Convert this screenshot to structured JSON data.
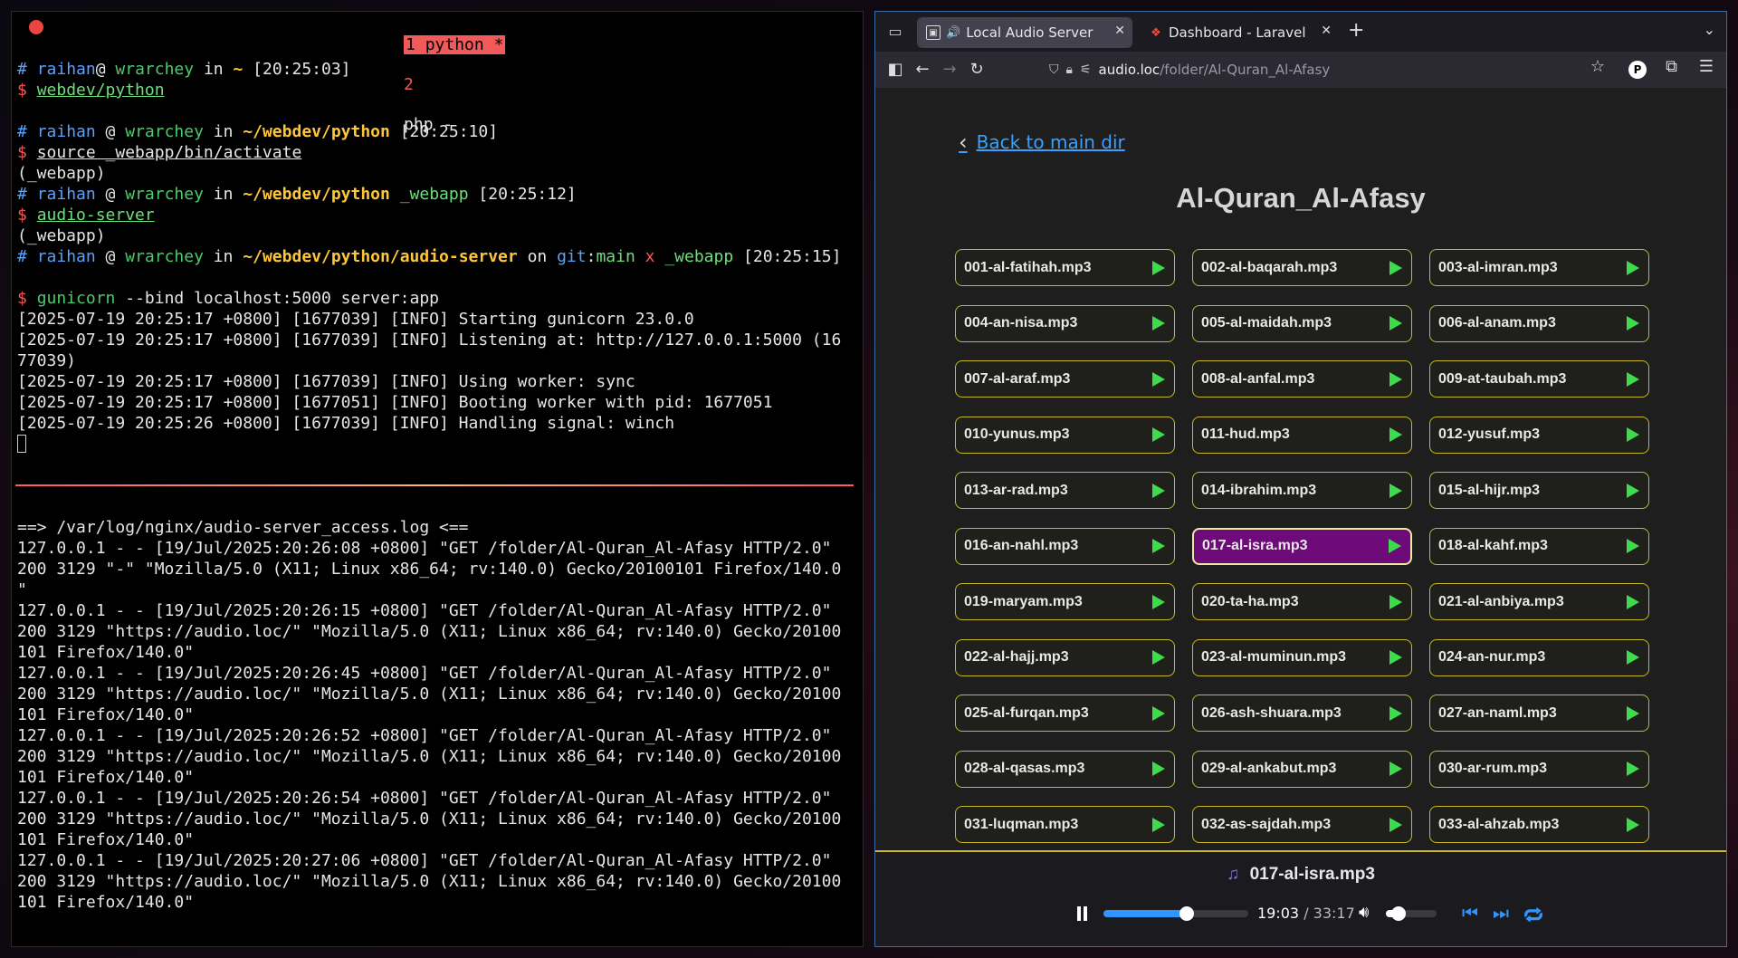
{
  "terminal": {
    "tabs": {
      "active": "1 python *",
      "other_num": "2",
      "other_label": "php -"
    },
    "lines": [
      [
        [
          "c-hash",
          "# "
        ],
        [
          "c-user",
          "raihan"
        ],
        [
          "",
          "@"
        ],
        [
          "c-host",
          " wrarchey"
        ],
        [
          "",
          " in "
        ],
        [
          "c-path",
          "~"
        ],
        [
          "",
          " [20:25:03]"
        ]
      ],
      [
        [
          "c-dollar",
          "$ "
        ],
        [
          "c-cmd",
          "webdev/python"
        ]
      ],
      [
        [
          "",
          ""
        ]
      ],
      [
        [
          "c-hash",
          "# "
        ],
        [
          "c-user",
          "raihan"
        ],
        [
          "",
          " @ "
        ],
        [
          "c-host",
          "wrarchey"
        ],
        [
          "",
          " in "
        ],
        [
          "c-path",
          "~/webdev/python"
        ],
        [
          "",
          " [20:25:10]"
        ]
      ],
      [
        [
          "c-dollar",
          "$ "
        ],
        [
          "c-cmd2",
          "source _webapp/bin/activate"
        ]
      ],
      [
        [
          "",
          "(_webapp)"
        ]
      ],
      [
        [
          "c-hash",
          "# "
        ],
        [
          "c-user",
          "raihan"
        ],
        [
          "",
          " @ "
        ],
        [
          "c-host",
          "wrarchey"
        ],
        [
          "",
          " in "
        ],
        [
          "c-path",
          "~/webdev/python"
        ],
        [
          "c-env2",
          " _webapp"
        ],
        [
          "",
          " [20:25:12]"
        ]
      ],
      [
        [
          "c-dollar",
          "$ "
        ],
        [
          "c-cmd",
          "audio-server"
        ]
      ],
      [
        [
          "",
          "(_webapp)"
        ]
      ],
      [
        [
          "c-hash",
          "# "
        ],
        [
          "c-user",
          "raihan"
        ],
        [
          "",
          " @ "
        ],
        [
          "c-host",
          "wrarchey"
        ],
        [
          "",
          " in "
        ],
        [
          "c-path",
          "~/webdev/python/audio-server"
        ],
        [
          "",
          " on "
        ],
        [
          "c-git",
          "git"
        ],
        [
          "",
          ":"
        ],
        [
          "c-branch",
          "main"
        ],
        [
          "c-dirty",
          " x"
        ],
        [
          "c-env2",
          " _webapp"
        ],
        [
          "",
          " [20:25:15]"
        ]
      ],
      [
        [
          "",
          ""
        ]
      ],
      [
        [
          "c-dollar",
          "$ "
        ],
        [
          "c-host",
          "gunicorn"
        ],
        [
          "",
          " --bind localhost:5000 server:app"
        ]
      ],
      [
        [
          "",
          "[2025-07-19 20:25:17 +0800] [1677039] [INFO] Starting gunicorn 23.0.0"
        ]
      ],
      [
        [
          "",
          "[2025-07-19 20:25:17 +0800] [1677039] [INFO] Listening at: http://127.0.0.1:5000 (16"
        ]
      ],
      [
        [
          "",
          "77039)"
        ]
      ],
      [
        [
          "",
          "[2025-07-19 20:25:17 +0800] [1677039] [INFO] Using worker: sync"
        ]
      ],
      [
        [
          "",
          "[2025-07-19 20:25:17 +0800] [1677051] [INFO] Booting worker with pid: 1677051"
        ]
      ],
      [
        [
          "",
          "[2025-07-19 20:25:26 +0800] [1677039] [INFO] Handling signal: winch"
        ]
      ]
    ],
    "log_lines": [
      "==> /var/log/nginx/audio-server_access.log <==",
      "127.0.0.1 - - [19/Jul/2025:20:26:08 +0800] \"GET /folder/Al-Quran_Al-Afasy HTTP/2.0\"",
      "200 3129 \"-\" \"Mozilla/5.0 (X11; Linux x86_64; rv:140.0) Gecko/20100101 Firefox/140.0",
      "\"",
      "127.0.0.1 - - [19/Jul/2025:20:26:15 +0800] \"GET /folder/Al-Quran_Al-Afasy HTTP/2.0\"",
      "200 3129 \"https://audio.loc/\" \"Mozilla/5.0 (X11; Linux x86_64; rv:140.0) Gecko/20100",
      "101 Firefox/140.0\"",
      "127.0.0.1 - - [19/Jul/2025:20:26:45 +0800] \"GET /folder/Al-Quran_Al-Afasy HTTP/2.0\"",
      "200 3129 \"https://audio.loc/\" \"Mozilla/5.0 (X11; Linux x86_64; rv:140.0) Gecko/20100",
      "101 Firefox/140.0\"",
      "127.0.0.1 - - [19/Jul/2025:20:26:52 +0800] \"GET /folder/Al-Quran_Al-Afasy HTTP/2.0\"",
      "200 3129 \"https://audio.loc/\" \"Mozilla/5.0 (X11; Linux x86_64; rv:140.0) Gecko/20100",
      "101 Firefox/140.0\"",
      "127.0.0.1 - - [19/Jul/2025:20:26:54 +0800] \"GET /folder/Al-Quran_Al-Afasy HTTP/2.0\"",
      "200 3129 \"https://audio.loc/\" \"Mozilla/5.0 (X11; Linux x86_64; rv:140.0) Gecko/20100",
      "101 Firefox/140.0\"",
      "127.0.0.1 - - [19/Jul/2025:20:27:06 +0800] \"GET /folder/Al-Quran_Al-Afasy HTTP/2.0\"",
      "200 3129 \"https://audio.loc/\" \"Mozilla/5.0 (X11; Linux x86_64; rv:140.0) Gecko/20100",
      "101 Firefox/140.0\""
    ]
  },
  "browser": {
    "tabs": [
      {
        "title": "Local Audio Server",
        "active": true,
        "icon": "audio-server-favicon",
        "speaker": "speaker-icon"
      },
      {
        "title": "Dashboard - Laravel",
        "active": false,
        "icon": "laravel-favicon"
      }
    ],
    "url": {
      "host": "audio.loc",
      "path": "/folder/Al-Quran_Al-Afasy"
    },
    "profile_letter": "P"
  },
  "page": {
    "back_label": "Back to main dir",
    "title": "Al-Quran_Al-Afasy",
    "files": [
      "001-al-fatihah.mp3",
      "002-al-baqarah.mp3",
      "003-al-imran.mp3",
      "004-an-nisa.mp3",
      "005-al-maidah.mp3",
      "006-al-anam.mp3",
      "007-al-araf.mp3",
      "008-al-anfal.mp3",
      "009-at-taubah.mp3",
      "010-yunus.mp3",
      "011-hud.mp3",
      "012-yusuf.mp3",
      "013-ar-rad.mp3",
      "014-ibrahim.mp3",
      "015-al-hijr.mp3",
      "016-an-nahl.mp3",
      "017-al-isra.mp3",
      "018-al-kahf.mp3",
      "019-maryam.mp3",
      "020-ta-ha.mp3",
      "021-al-anbiya.mp3",
      "022-al-hajj.mp3",
      "023-al-muminun.mp3",
      "024-an-nur.mp3",
      "025-al-furqan.mp3",
      "026-ash-shuara.mp3",
      "027-an-naml.mp3",
      "028-al-qasas.mp3",
      "029-al-ankabut.mp3",
      "030-ar-rum.mp3",
      "031-luqman.mp3",
      "032-as-sajdah.mp3",
      "033-al-ahzab.mp3"
    ],
    "active_file": "017-al-isra.mp3",
    "colors": {
      "accent_border": "#c9b82a",
      "active_bg": "#6f0a7a",
      "play": "#3ddc4c",
      "link": "#3aa0ff"
    }
  },
  "player": {
    "now_playing": "017-al-isra.mp3",
    "current_time": "19:03",
    "separator": " / ",
    "total_time": "33:17",
    "progress_fraction": 0.572,
    "volume_fraction": 0.25
  }
}
